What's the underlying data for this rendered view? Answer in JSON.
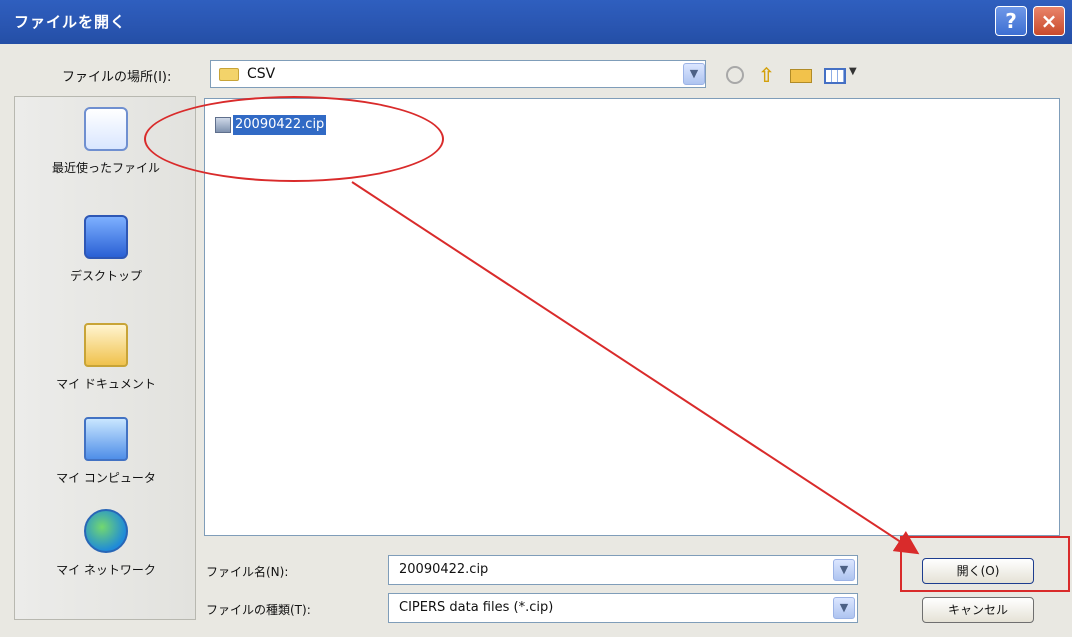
{
  "window": {
    "title": "ファイルを開く",
    "help_icon": "?",
    "close_icon": "×"
  },
  "look_in": {
    "label": "ファイルの場所(I):",
    "value": "CSV",
    "dropdown_arrow": "▼"
  },
  "toolbar": {
    "back_icon": "back-icon",
    "up_icon": "up-folder-icon",
    "new_folder_icon": "new-folder-icon",
    "views_icon": "views-icon",
    "views_arrow": "▼"
  },
  "places": [
    {
      "label": "最近使ったファイル",
      "icon": "recent-documents-icon"
    },
    {
      "label": "デスクトップ",
      "icon": "desktop-icon"
    },
    {
      "label": "マイ ドキュメント",
      "icon": "my-documents-icon"
    },
    {
      "label": "マイ コンピュータ",
      "icon": "my-computer-icon"
    },
    {
      "label": "マイ ネットワーク",
      "icon": "my-network-icon"
    }
  ],
  "files": [
    {
      "name": "20090422.cip",
      "selected": true
    }
  ],
  "fields": {
    "filename_label": "ファイル名(N):",
    "filename_value": "20090422.cip",
    "filetype_label": "ファイルの種類(T):",
    "filetype_value": "CIPERS data files (*.cip)",
    "arrow": "▼"
  },
  "buttons": {
    "open": "開く(O)",
    "cancel": "キャンセル"
  },
  "annotations": {
    "highlight_color": "#d92b2b"
  }
}
